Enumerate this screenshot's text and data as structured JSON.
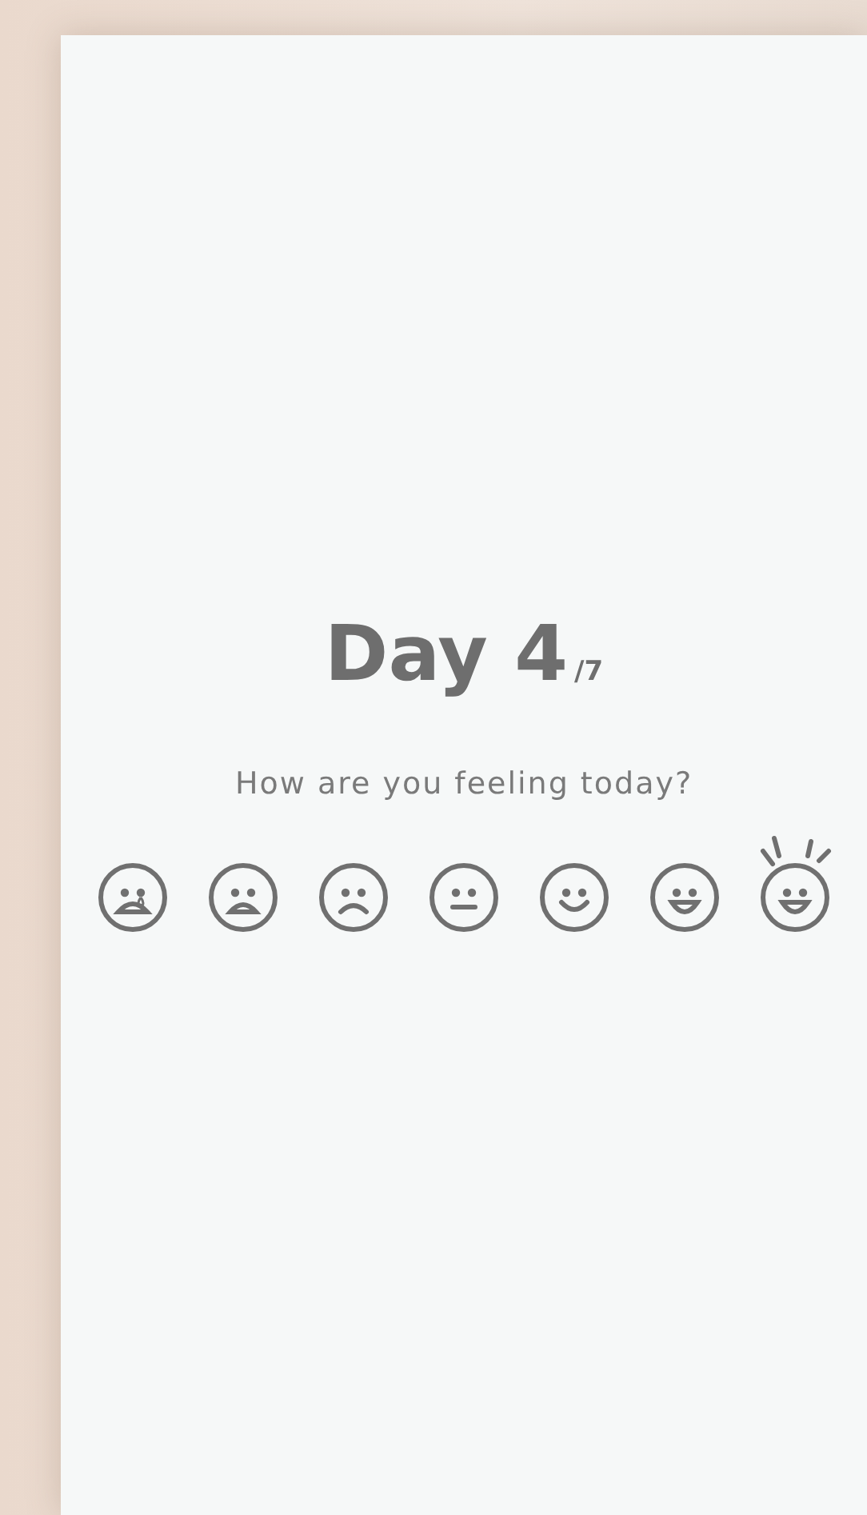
{
  "heading": {
    "day": "Day 4",
    "total": "/7"
  },
  "question": "How are you feeling today?",
  "moods": [
    {
      "kind": "crying"
    },
    {
      "kind": "distressed"
    },
    {
      "kind": "sad"
    },
    {
      "kind": "neutral"
    },
    {
      "kind": "smile"
    },
    {
      "kind": "happy"
    },
    {
      "kind": "excited"
    }
  ]
}
